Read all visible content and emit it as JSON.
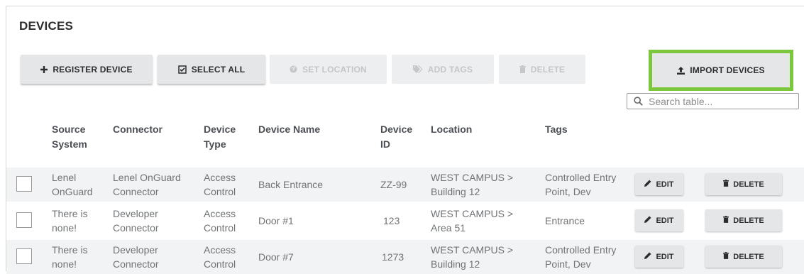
{
  "page": {
    "title": "DEVICES"
  },
  "toolbar": {
    "register": "REGISTER DEVICE",
    "select_all": "SELECT ALL",
    "set_location": "SET LOCATION",
    "add_tags": "ADD TAGS",
    "delete": "DELETE",
    "import": "IMPORT DEVICES",
    "highlight_color": "#7dc73e"
  },
  "search": {
    "placeholder": "Search table..."
  },
  "table": {
    "headers": {
      "source_system": "Source\nSystem",
      "connector": "Connector",
      "device_type": "Device\nType",
      "device_name": "Device Name",
      "device_id": "Device\nID",
      "location": "Location",
      "tags": "Tags"
    },
    "rows": [
      {
        "source": "Lenel\nOnGuard",
        "connector": "Lenel OnGuard\nConnector",
        "type": "Access\nControl",
        "name": "Back Entrance",
        "id": "ZZ-99",
        "location": "WEST CAMPUS >\nBuilding 12",
        "tags": "Controlled Entry\nPoint, Dev",
        "edit": "EDIT",
        "delete": "DELETE"
      },
      {
        "source": "There is\nnone!",
        "connector": "Developer\nConnector",
        "type": "Access\nControl",
        "name": "Door #1",
        "id": "123",
        "location": "WEST CAMPUS >\nArea 51",
        "tags": "Entrance",
        "edit": "EDIT",
        "delete": "DELETE"
      },
      {
        "source": "There is\nnone!",
        "connector": "Developer\nConnector",
        "type": "Access\nControl",
        "name": "Door #7",
        "id": "1273",
        "location": "WEST CAMPUS >\nBuilding 12",
        "tags": "Controlled Entry\nPoint, Dev",
        "edit": "EDIT",
        "delete": "DELETE"
      }
    ]
  }
}
